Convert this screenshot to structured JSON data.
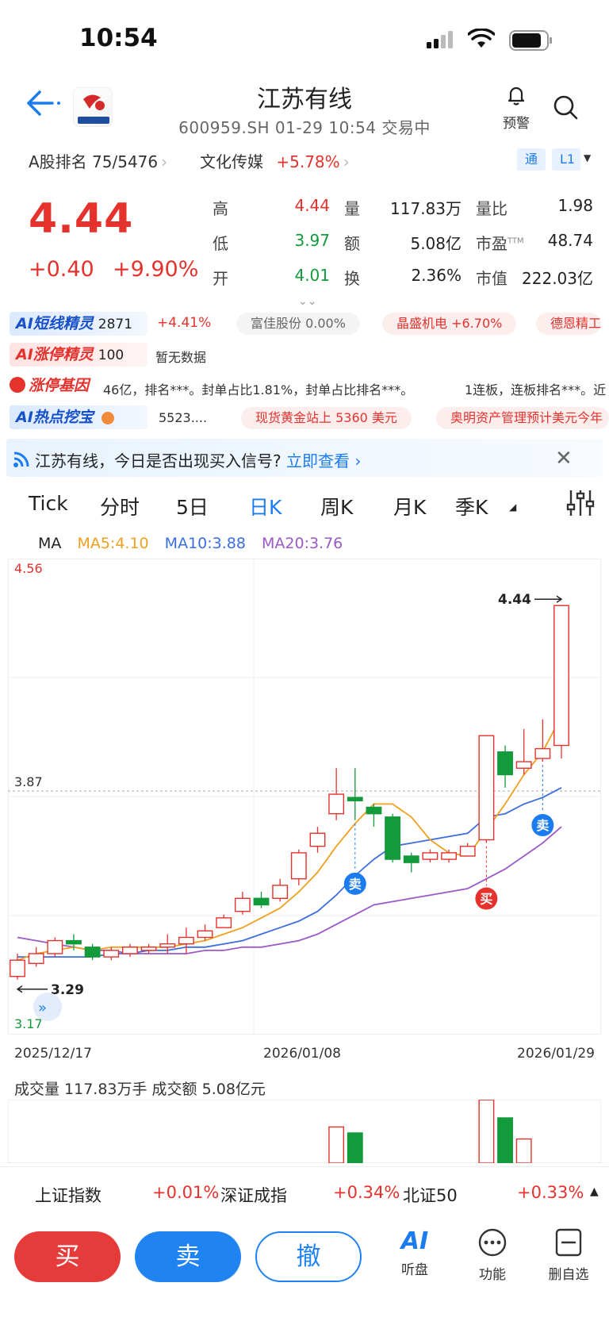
{
  "status_bar": {
    "time": "10:54"
  },
  "header": {
    "title": "江苏有线",
    "subtitle": "600959.SH 01-29 10:54 交易中",
    "alert_label": "预警"
  },
  "rank": {
    "label": "A股排名 75/5476",
    "sector": "文化传媒",
    "sector_change": "+5.78%"
  },
  "tags": {
    "tong": "通",
    "level": "L1"
  },
  "quote": {
    "price": "4.44",
    "change": "+0.40",
    "change_pct": "+9.90%",
    "fields": [
      {
        "label": "高",
        "value": "4.44"
      },
      {
        "label": "量",
        "value": "117.83万"
      },
      {
        "label": "量比",
        "value": "1.98"
      },
      {
        "label": "低",
        "value": "3.97"
      },
      {
        "label": "额",
        "value": "5.08亿"
      },
      {
        "label": "市盈",
        "value": "48.74"
      },
      {
        "label": "开",
        "value": "4.01"
      },
      {
        "label": "换",
        "value": "2.36%"
      },
      {
        "label": "市值",
        "value": "222.03亿"
      }
    ],
    "pe_superscript": "TTM"
  },
  "ai_rows": {
    "short_line": {
      "title": "AI短线精灵",
      "count": "2871",
      "change": "+4.41%",
      "chips": [
        "富佳股份 0.00%",
        "晶盛机电 +6.70%",
        "德恩精工"
      ]
    },
    "limit_up": {
      "title": "AI涨停精灵",
      "count": "100",
      "text": "暂无数据"
    },
    "gene": {
      "title": "涨停基因",
      "text1": "46亿，排名***。封单占比1.81%，封单占比排名***。",
      "text2": "1连板，连板排名***。近"
    },
    "hot": {
      "title": "AI热点挖宝",
      "text": "5523....",
      "chips": [
        "现货黄金站上 5360 美元",
        "奥明资产管理预计美元今年"
      ]
    }
  },
  "signal": {
    "text": "江苏有线，今日是否出现买入信号?",
    "link": "立即查看"
  },
  "tabs": [
    "Tick",
    "分时",
    "5日",
    "日K",
    "周K",
    "月K",
    "季K"
  ],
  "active_tab": "日K",
  "ma": {
    "label": "MA",
    "ma5": "MA5:4.10",
    "ma10": "MA10:3.88",
    "ma20": "MA20:3.76"
  },
  "colors": {
    "up": "#e5322d",
    "down": "#139a3b",
    "ma5": "#f0a020",
    "ma10": "#3d6ee0",
    "ma20": "#9b59c8"
  },
  "chart_data": {
    "type": "candlestick",
    "axis_top": "4.56",
    "axis_mid": "3.87",
    "axis_bottom": "3.17",
    "ylim": [
      3.17,
      4.56
    ],
    "max_label": "4.44",
    "min_label": "3.29",
    "dates": [
      "2025/12/17",
      "2026/01/08",
      "2026/01/29"
    ],
    "candles": [
      [
        3.3,
        3.35,
        3.37,
        3.29
      ],
      [
        3.34,
        3.37,
        3.39,
        3.33
      ],
      [
        3.37,
        3.41,
        3.42,
        3.36
      ],
      [
        3.41,
        3.4,
        3.43,
        3.38
      ],
      [
        3.39,
        3.36,
        3.4,
        3.35
      ],
      [
        3.36,
        3.38,
        3.39,
        3.35
      ],
      [
        3.37,
        3.39,
        3.4,
        3.36
      ],
      [
        3.38,
        3.39,
        3.4,
        3.37
      ],
      [
        3.39,
        3.4,
        3.43,
        3.37
      ],
      [
        3.4,
        3.42,
        3.45,
        3.37
      ],
      [
        3.42,
        3.44,
        3.46,
        3.41
      ],
      [
        3.45,
        3.48,
        3.49,
        3.45
      ],
      [
        3.5,
        3.54,
        3.56,
        3.49
      ],
      [
        3.54,
        3.52,
        3.56,
        3.51
      ],
      [
        3.54,
        3.58,
        3.6,
        3.53
      ],
      [
        3.6,
        3.68,
        3.69,
        3.58
      ],
      [
        3.7,
        3.74,
        3.76,
        3.68
      ],
      [
        3.8,
        3.86,
        3.94,
        3.78
      ],
      [
        3.85,
        3.84,
        3.94,
        3.78
      ],
      [
        3.82,
        3.8,
        3.83,
        3.76
      ],
      [
        3.79,
        3.66,
        3.8,
        3.65
      ],
      [
        3.67,
        3.65,
        3.68,
        3.62
      ],
      [
        3.66,
        3.68,
        3.69,
        3.65
      ],
      [
        3.66,
        3.68,
        3.69,
        3.65
      ],
      [
        3.67,
        3.7,
        3.71,
        3.67
      ],
      [
        3.72,
        4.04,
        4.04,
        3.71
      ],
      [
        3.99,
        3.92,
        4.01,
        3.88
      ],
      [
        3.94,
        3.96,
        4.06,
        3.92
      ],
      [
        3.97,
        4.0,
        4.09,
        3.96
      ],
      [
        4.01,
        4.44,
        4.44,
        3.97
      ]
    ],
    "ma5": [
      3.35,
      3.37,
      3.38,
      3.39,
      3.38,
      3.39,
      3.39,
      3.39,
      3.39,
      3.4,
      3.41,
      3.43,
      3.45,
      3.48,
      3.51,
      3.56,
      3.62,
      3.7,
      3.77,
      3.83,
      3.83,
      3.79,
      3.72,
      3.68,
      3.67,
      3.75,
      3.83,
      3.92,
      3.99,
      4.1
    ],
    "ma10": [
      3.36,
      3.36,
      3.36,
      3.36,
      3.36,
      3.37,
      3.37,
      3.38,
      3.38,
      3.39,
      3.39,
      3.4,
      3.41,
      3.43,
      3.45,
      3.47,
      3.5,
      3.55,
      3.61,
      3.66,
      3.7,
      3.71,
      3.72,
      3.73,
      3.74,
      3.79,
      3.8,
      3.83,
      3.85,
      3.88
    ],
    "ma20": [
      3.42,
      3.41,
      3.4,
      3.39,
      3.38,
      3.38,
      3.37,
      3.37,
      3.37,
      3.37,
      3.38,
      3.38,
      3.39,
      3.39,
      3.4,
      3.41,
      3.43,
      3.46,
      3.49,
      3.52,
      3.53,
      3.54,
      3.55,
      3.56,
      3.57,
      3.6,
      3.63,
      3.67,
      3.71,
      3.76
    ],
    "signals": [
      {
        "index": 18,
        "label": "卖",
        "type": "sell"
      },
      {
        "index": 25,
        "label": "买",
        "type": "buy"
      },
      {
        "index": 28,
        "label": "卖",
        "type": "sell"
      }
    ]
  },
  "volume": {
    "label": "成交量 117.83万手  成交额 5.08亿元"
  },
  "indices": [
    {
      "name": "上证指数",
      "value": "+0.01%"
    },
    {
      "name": "深证成指",
      "value": "+0.34%"
    },
    {
      "name": "北证50",
      "value": "+0.33%"
    }
  ],
  "bottom": {
    "buy": "买",
    "sell": "卖",
    "cancel": "撤",
    "listen": "听盘",
    "function": "功能",
    "remove_watch": "删自选",
    "ai": "AI"
  }
}
